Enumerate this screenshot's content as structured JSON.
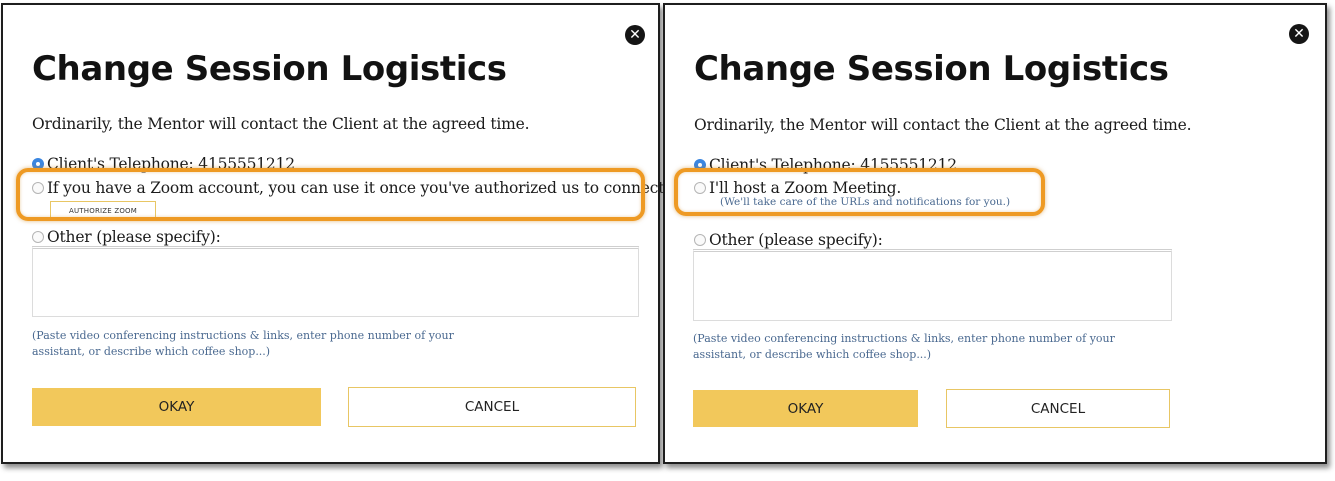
{
  "left_dialog": {
    "title": "Change Session Logistics",
    "intro": "Ordinarily, the Mentor will contact the Client at the agreed time.",
    "option_phone": "Client's Telephone: 4155551212",
    "option_zoom": "If you have a Zoom account, you can use it once you've authorized us to connect.",
    "authorize_button": "AUTHORIZE ZOOM",
    "option_other": "Other (please specify):",
    "hint": "(Paste video conferencing instructions & links, enter phone number of your assistant, or describe which coffee shop...)",
    "okay_label": "OKAY",
    "cancel_label": "CANCEL"
  },
  "right_dialog": {
    "title": "Change Session Logistics",
    "intro": "Ordinarily, the Mentor will contact the Client at the agreed time.",
    "option_phone": "Client's Telephone: 4155551212",
    "option_zoom": "I'll host a Zoom Meeting.",
    "option_zoom_sub": "(We'll take care of the URLs and notifications for you.)",
    "option_other": "Other (please specify):",
    "hint": "(Paste video conferencing instructions & links, enter phone number of your assistant, or describe which coffee shop...)",
    "okay_label": "OKAY",
    "cancel_label": "CANCEL"
  },
  "icons": {
    "close": "close-circle-icon",
    "selected_radio": "radio-checked-icon"
  },
  "colors": {
    "accent": "#f2c85b",
    "highlight": "#ee9a24",
    "radio_selected": "#3b86e0",
    "hint_text": "#4a6990"
  }
}
